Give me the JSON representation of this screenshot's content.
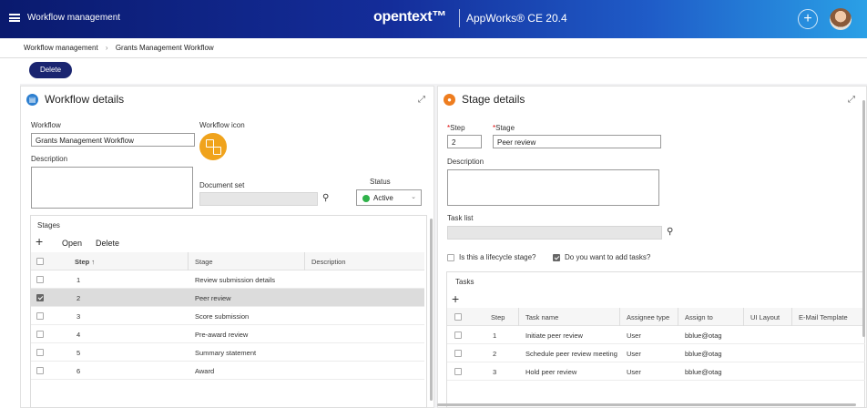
{
  "header": {
    "app_title": "Workflow management",
    "brand": "opentext™",
    "product": "AppWorks® CE 20.4",
    "add_label": "+"
  },
  "breadcrumb": {
    "items": [
      "Workflow management",
      "Grants Management Workflow"
    ],
    "separator": "›"
  },
  "toolbar": {
    "delete_label": "Delete"
  },
  "workflow_panel": {
    "title": "Workflow details",
    "icon": "document-icon",
    "icon_color": "#2d7fd0",
    "workflow_label": "Workflow",
    "workflow_value": "Grants Management Workflow",
    "icon_label": "Workflow icon",
    "description_label": "Description",
    "description_value": "",
    "document_set_label": "Document set",
    "document_set_value": "",
    "status_label": "Status",
    "status_value": "Active",
    "status_color": "#2fb24a",
    "stages": {
      "title": "Stages",
      "open_label": "Open",
      "delete_label": "Delete",
      "columns": [
        "Step ↑",
        "Stage",
        "Description"
      ],
      "rows": [
        {
          "step": "1",
          "stage": "Review submission details",
          "selected": false
        },
        {
          "step": "2",
          "stage": "Peer review",
          "selected": true
        },
        {
          "step": "3",
          "stage": "Score submission",
          "selected": false
        },
        {
          "step": "4",
          "stage": "Pre-award review",
          "selected": false
        },
        {
          "step": "5",
          "stage": "Summary statement",
          "selected": false
        },
        {
          "step": "6",
          "stage": "Award",
          "selected": false
        }
      ]
    }
  },
  "stage_panel": {
    "title": "Stage details",
    "icon": "stage-icon",
    "icon_color": "#ee7d1f",
    "step_label": "Step",
    "step_value": "2",
    "stage_label": "Stage",
    "stage_value": "Peer review",
    "description_label": "Description",
    "description_value": "",
    "task_list_label": "Task list",
    "task_list_value": "",
    "lifecycle_label": "Is this a lifecycle stage?",
    "lifecycle_checked": false,
    "add_tasks_label": "Do you want to add tasks?",
    "add_tasks_checked": true,
    "tasks": {
      "title": "Tasks",
      "columns": [
        "Step",
        "Task name",
        "Assignee type",
        "Assign to",
        "UI Layout",
        "E-Mail Template"
      ],
      "rows": [
        {
          "step": "1",
          "task": "Initiate peer review",
          "type": "User",
          "assign": "bblue@otag"
        },
        {
          "step": "2",
          "task": "Schedule peer review meeting",
          "type": "User",
          "assign": "bblue@otag"
        },
        {
          "step": "3",
          "task": "Hold peer review",
          "type": "User",
          "assign": "bblue@otag"
        }
      ]
    }
  }
}
